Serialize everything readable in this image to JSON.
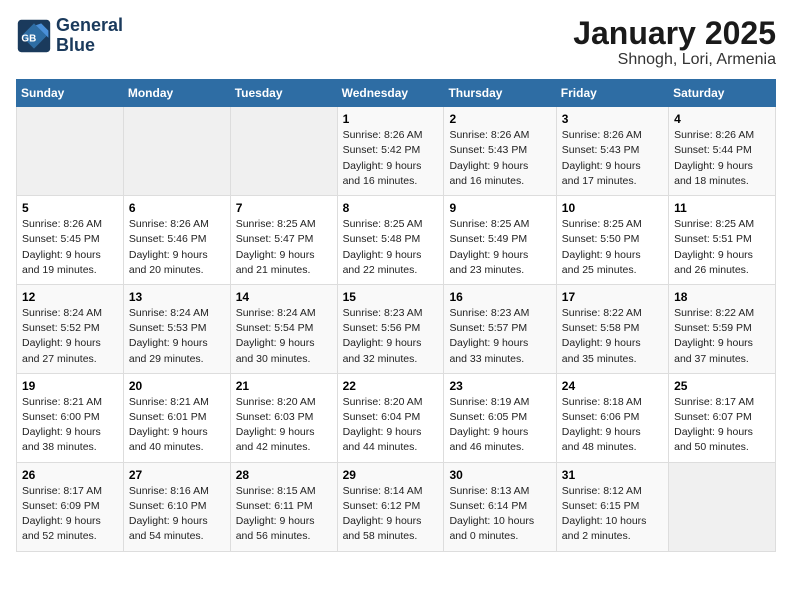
{
  "logo": {
    "line1": "General",
    "line2": "Blue"
  },
  "calendar": {
    "title": "January 2025",
    "subtitle": "Shnogh, Lori, Armenia"
  },
  "weekdays": [
    "Sunday",
    "Monday",
    "Tuesday",
    "Wednesday",
    "Thursday",
    "Friday",
    "Saturday"
  ],
  "weeks": [
    [
      {
        "day": "",
        "detail": ""
      },
      {
        "day": "",
        "detail": ""
      },
      {
        "day": "",
        "detail": ""
      },
      {
        "day": "1",
        "detail": "Sunrise: 8:26 AM\nSunset: 5:42 PM\nDaylight: 9 hours\nand 16 minutes."
      },
      {
        "day": "2",
        "detail": "Sunrise: 8:26 AM\nSunset: 5:43 PM\nDaylight: 9 hours\nand 16 minutes."
      },
      {
        "day": "3",
        "detail": "Sunrise: 8:26 AM\nSunset: 5:43 PM\nDaylight: 9 hours\nand 17 minutes."
      },
      {
        "day": "4",
        "detail": "Sunrise: 8:26 AM\nSunset: 5:44 PM\nDaylight: 9 hours\nand 18 minutes."
      }
    ],
    [
      {
        "day": "5",
        "detail": "Sunrise: 8:26 AM\nSunset: 5:45 PM\nDaylight: 9 hours\nand 19 minutes."
      },
      {
        "day": "6",
        "detail": "Sunrise: 8:26 AM\nSunset: 5:46 PM\nDaylight: 9 hours\nand 20 minutes."
      },
      {
        "day": "7",
        "detail": "Sunrise: 8:25 AM\nSunset: 5:47 PM\nDaylight: 9 hours\nand 21 minutes."
      },
      {
        "day": "8",
        "detail": "Sunrise: 8:25 AM\nSunset: 5:48 PM\nDaylight: 9 hours\nand 22 minutes."
      },
      {
        "day": "9",
        "detail": "Sunrise: 8:25 AM\nSunset: 5:49 PM\nDaylight: 9 hours\nand 23 minutes."
      },
      {
        "day": "10",
        "detail": "Sunrise: 8:25 AM\nSunset: 5:50 PM\nDaylight: 9 hours\nand 25 minutes."
      },
      {
        "day": "11",
        "detail": "Sunrise: 8:25 AM\nSunset: 5:51 PM\nDaylight: 9 hours\nand 26 minutes."
      }
    ],
    [
      {
        "day": "12",
        "detail": "Sunrise: 8:24 AM\nSunset: 5:52 PM\nDaylight: 9 hours\nand 27 minutes."
      },
      {
        "day": "13",
        "detail": "Sunrise: 8:24 AM\nSunset: 5:53 PM\nDaylight: 9 hours\nand 29 minutes."
      },
      {
        "day": "14",
        "detail": "Sunrise: 8:24 AM\nSunset: 5:54 PM\nDaylight: 9 hours\nand 30 minutes."
      },
      {
        "day": "15",
        "detail": "Sunrise: 8:23 AM\nSunset: 5:56 PM\nDaylight: 9 hours\nand 32 minutes."
      },
      {
        "day": "16",
        "detail": "Sunrise: 8:23 AM\nSunset: 5:57 PM\nDaylight: 9 hours\nand 33 minutes."
      },
      {
        "day": "17",
        "detail": "Sunrise: 8:22 AM\nSunset: 5:58 PM\nDaylight: 9 hours\nand 35 minutes."
      },
      {
        "day": "18",
        "detail": "Sunrise: 8:22 AM\nSunset: 5:59 PM\nDaylight: 9 hours\nand 37 minutes."
      }
    ],
    [
      {
        "day": "19",
        "detail": "Sunrise: 8:21 AM\nSunset: 6:00 PM\nDaylight: 9 hours\nand 38 minutes."
      },
      {
        "day": "20",
        "detail": "Sunrise: 8:21 AM\nSunset: 6:01 PM\nDaylight: 9 hours\nand 40 minutes."
      },
      {
        "day": "21",
        "detail": "Sunrise: 8:20 AM\nSunset: 6:03 PM\nDaylight: 9 hours\nand 42 minutes."
      },
      {
        "day": "22",
        "detail": "Sunrise: 8:20 AM\nSunset: 6:04 PM\nDaylight: 9 hours\nand 44 minutes."
      },
      {
        "day": "23",
        "detail": "Sunrise: 8:19 AM\nSunset: 6:05 PM\nDaylight: 9 hours\nand 46 minutes."
      },
      {
        "day": "24",
        "detail": "Sunrise: 8:18 AM\nSunset: 6:06 PM\nDaylight: 9 hours\nand 48 minutes."
      },
      {
        "day": "25",
        "detail": "Sunrise: 8:17 AM\nSunset: 6:07 PM\nDaylight: 9 hours\nand 50 minutes."
      }
    ],
    [
      {
        "day": "26",
        "detail": "Sunrise: 8:17 AM\nSunset: 6:09 PM\nDaylight: 9 hours\nand 52 minutes."
      },
      {
        "day": "27",
        "detail": "Sunrise: 8:16 AM\nSunset: 6:10 PM\nDaylight: 9 hours\nand 54 minutes."
      },
      {
        "day": "28",
        "detail": "Sunrise: 8:15 AM\nSunset: 6:11 PM\nDaylight: 9 hours\nand 56 minutes."
      },
      {
        "day": "29",
        "detail": "Sunrise: 8:14 AM\nSunset: 6:12 PM\nDaylight: 9 hours\nand 58 minutes."
      },
      {
        "day": "30",
        "detail": "Sunrise: 8:13 AM\nSunset: 6:14 PM\nDaylight: 10 hours\nand 0 minutes."
      },
      {
        "day": "31",
        "detail": "Sunrise: 8:12 AM\nSunset: 6:15 PM\nDaylight: 10 hours\nand 2 minutes."
      },
      {
        "day": "",
        "detail": ""
      }
    ]
  ]
}
